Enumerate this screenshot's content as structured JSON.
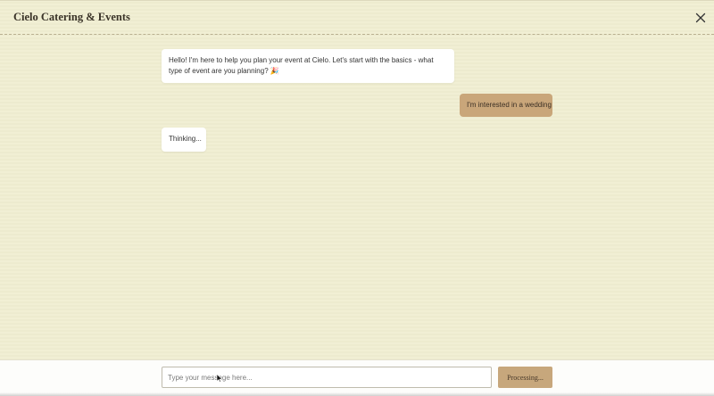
{
  "header": {
    "title": "Cielo Catering & Events",
    "close_icon": "close-icon"
  },
  "messages": [
    {
      "role": "assistant",
      "text": "Hello! I'm here to help you plan your event at Cielo. Let's start with the basics - what type of event are you planning? 🎉"
    },
    {
      "role": "user",
      "text": "I'm interested in a wedding"
    },
    {
      "role": "assistant",
      "text": "Thinking..."
    }
  ],
  "composer": {
    "placeholder": "Type your message here...",
    "value": "",
    "send_label": "Processing..."
  },
  "colors": {
    "background": "#f0eed1",
    "user_bubble": "#c9a67a",
    "send_button": "#c7a77c",
    "assistant_bubble": "#ffffff"
  }
}
